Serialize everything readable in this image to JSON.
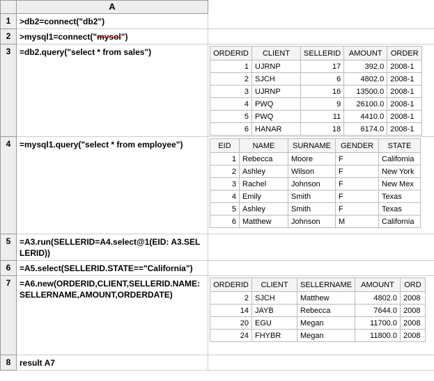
{
  "column_header": "A",
  "rows": {
    "1": ">db2=connect(\"db2\")",
    "2_pre": ">mysql1=connect(\"",
    "2_strike": "mysol",
    "2_post": "\")",
    "3": "=db2.query(\"select  * from sales\")",
    "4": "=mysql1.query(\"select  * from employee\")",
    "5": "=A3.run(SELLERID=A4.select@1(EID: A3.SELLERID))",
    "6": "=A5.select(SELLERID.STATE==\"California\")",
    "7": "=A6.new(ORDERID,CLIENT,SELLERID.NAME:SELLERNAME,AMOUNT,ORDERDATE)",
    "8": "result A7"
  },
  "sales": {
    "headers": [
      "ORDERID",
      "CLIENT",
      "SELLERID",
      "AMOUNT",
      "ORDER"
    ],
    "widths": [
      60,
      70,
      62,
      62,
      50
    ],
    "rows": [
      [
        "1",
        "UJRNP",
        "17",
        "392.0",
        "2008-1"
      ],
      [
        "2",
        "SJCH",
        "6",
        "4802.0",
        "2008-1"
      ],
      [
        "3",
        "UJRNP",
        "16",
        "13500.0",
        "2008-1"
      ],
      [
        "4",
        "PWQ",
        "9",
        "26100.0",
        "2008-1"
      ],
      [
        "5",
        "PWQ",
        "11",
        "4410.0",
        "2008-1"
      ],
      [
        "6",
        "HANAR",
        "18",
        "6174.0",
        "2008-1"
      ]
    ],
    "aligns": [
      "num",
      "txt",
      "num",
      "num",
      "txt"
    ]
  },
  "employee": {
    "headers": [
      "EID",
      "NAME",
      "SURNAME",
      "GENDER",
      "STATE"
    ],
    "widths": [
      42,
      70,
      68,
      62,
      60
    ],
    "rows": [
      [
        "1",
        "Rebecca",
        "Moore",
        "F",
        "California"
      ],
      [
        "2",
        "Ashley",
        "Wilson",
        "F",
        "New York"
      ],
      [
        "3",
        "Rachel",
        "Johnson",
        "F",
        "New Mex"
      ],
      [
        "4",
        "Emily",
        "Smith",
        "F",
        "Texas"
      ],
      [
        "5",
        "Ashley",
        "Smith",
        "F",
        "Texas"
      ],
      [
        "6",
        "Matthew",
        "Johnson",
        "M",
        "California"
      ]
    ],
    "aligns": [
      "num",
      "txt",
      "txt",
      "txt",
      "txt"
    ]
  },
  "result": {
    "headers": [
      "ORDERID",
      "CLIENT",
      "SELLERNAME",
      "AMOUNT",
      "ORD"
    ],
    "widths": [
      60,
      65,
      78,
      65,
      36
    ],
    "rows": [
      [
        "2",
        "SJCH",
        "Matthew",
        "4802.0",
        "2008"
      ],
      [
        "14",
        "JAYB",
        "Rebecca",
        "7644.0",
        "2008"
      ],
      [
        "20",
        "EGU",
        "Megan",
        "11700.0",
        "2008"
      ],
      [
        "24",
        "FHYBR",
        "Megan",
        "11800.0",
        "2008"
      ]
    ],
    "aligns": [
      "num",
      "txt",
      "txt",
      "num",
      "txt"
    ]
  }
}
